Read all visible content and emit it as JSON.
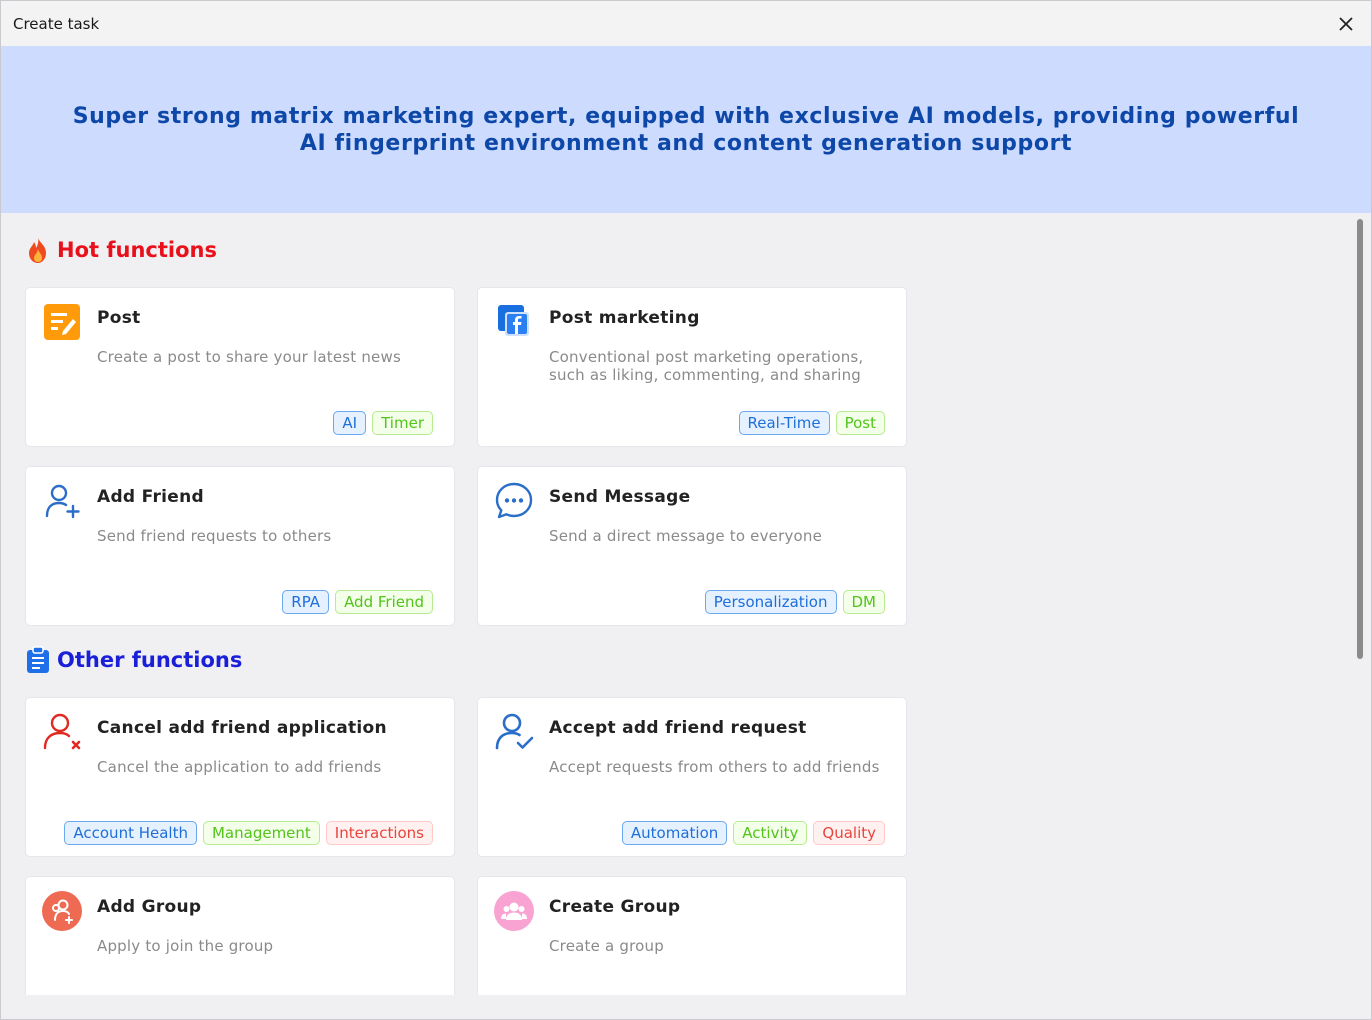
{
  "window": {
    "title": "Create task"
  },
  "banner": {
    "text": "Super strong matrix marketing expert, equipped with exclusive AI models, providing powerful AI fingerprint environment and content generation support"
  },
  "sections": {
    "hot": {
      "title": "Hot functions",
      "icon": "fire-icon"
    },
    "other": {
      "title": "Other functions",
      "icon": "clipboard-icon"
    }
  },
  "cards": [
    {
      "title": "Post",
      "desc": "Create a post to share your latest news",
      "icon": "edit-post-icon",
      "tags": [
        "AI",
        "Timer"
      ]
    },
    {
      "title": "Post marketing",
      "desc": "Conventional post marketing operations, such as liking, commenting, and sharing",
      "icon": "facebook-icon",
      "tags": [
        "Real-Time",
        "Post"
      ]
    },
    {
      "title": "Add Friend",
      "desc": "Send friend requests to others",
      "icon": "user-plus-icon",
      "tags": [
        "RPA",
        "Add Friend"
      ]
    },
    {
      "title": "Send Message",
      "desc": "Send a direct message to everyone",
      "icon": "chat-bubble-icon",
      "tags": [
        "Personalization",
        "DM"
      ]
    },
    {
      "title": "Cancel add friend application",
      "desc": "Cancel the application to add friends",
      "icon": "user-remove-icon",
      "tags": [
        "Account Health",
        "Management",
        "Interactions"
      ]
    },
    {
      "title": "Accept add friend request",
      "desc": "Accept requests from others to add friends",
      "icon": "user-check-icon",
      "tags": [
        "Automation",
        "Activity",
        "Quality"
      ]
    },
    {
      "title": "Add Group",
      "desc": "Apply to join the group",
      "icon": "group-add-icon",
      "tags": []
    },
    {
      "title": "Create Group",
      "desc": "Create a group",
      "icon": "group-icon",
      "tags": []
    }
  ],
  "colors": {
    "banner_bg": "#ccdbfe",
    "banner_text": "#0d47a8",
    "hot_title": "#e8101a",
    "other_title": "#1a20d8",
    "tag_blue": "#1e6fd9",
    "tag_green": "#52c41a",
    "tag_red": "#e8453c"
  }
}
